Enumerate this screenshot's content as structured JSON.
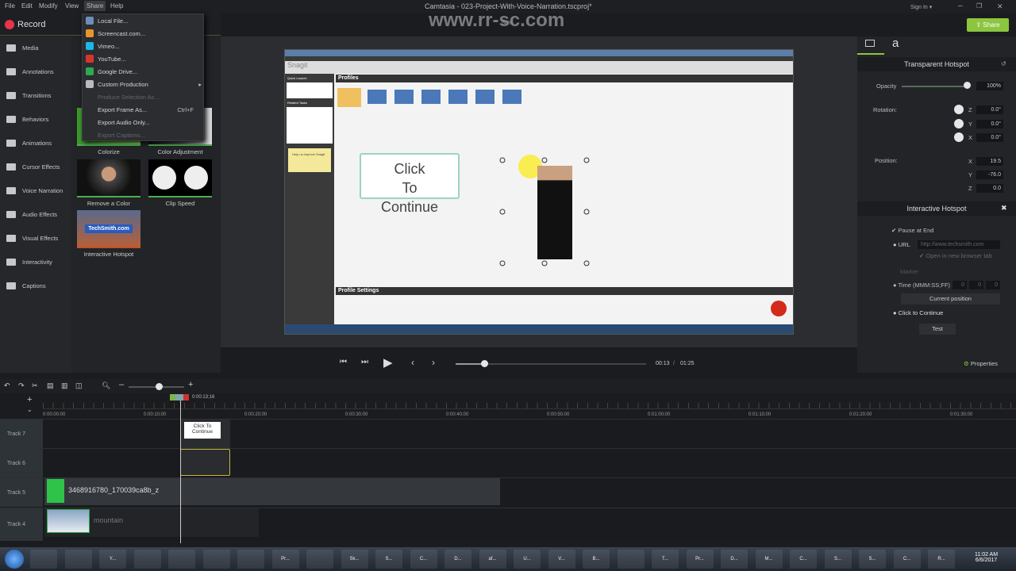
{
  "app": {
    "title": "Camtasia - 023-Project-With-Voice-Narration.tscproj*",
    "sign_in": "Sign In ▾",
    "share": "Share",
    "watermark": "www.rr-sc.com",
    "zoom": "50%",
    "accent": "#8cc63f"
  },
  "menu": [
    "File",
    "Edit",
    "Modify",
    "View",
    "Share",
    "Help"
  ],
  "record": "Record",
  "share_menu": [
    {
      "label": "Local File...",
      "icon": "local-file-icon",
      "color": "#6b8fb8",
      "disabled": false
    },
    {
      "label": "Screencast.com...",
      "icon": "screencast-icon",
      "color": "#e8962a",
      "disabled": false
    },
    {
      "label": "Vimeo...",
      "icon": "vimeo-icon",
      "color": "#1ab7ea",
      "disabled": false
    },
    {
      "label": "YouTube...",
      "icon": "youtube-icon",
      "color": "#d9342b",
      "disabled": false
    },
    {
      "label": "Google Drive...",
      "icon": "google-drive-icon",
      "color": "#2fa84f",
      "disabled": false
    },
    {
      "label": "Custom Production",
      "icon": "tools-icon",
      "color": "#bbbbbb",
      "disabled": false,
      "submenu": true
    },
    {
      "label": "Produce Selection As...",
      "icon": "",
      "color": "",
      "disabled": true
    },
    {
      "label": "Export Frame As...",
      "icon": "",
      "color": "",
      "disabled": false,
      "shortcut": "Ctrl+F"
    },
    {
      "label": "Export Audio Only...",
      "icon": "",
      "color": "",
      "disabled": false
    },
    {
      "label": "Export Captions...",
      "icon": "",
      "color": "",
      "disabled": true
    }
  ],
  "sidebar": [
    "Media",
    "Annotations",
    "Transitions",
    "Behaviors",
    "Animations",
    "Cursor Effects",
    "Voice Narration",
    "Audio Effects",
    "Visual Effects",
    "Interactivity",
    "Captions"
  ],
  "effects": [
    "Colorize",
    "Color Adjustment",
    "Remove a Color",
    "Clip Speed",
    "Interactive Hotspot"
  ],
  "hotspot_thumb_text": "TechSmith.com",
  "canvas": {
    "callout": "Click To Continue",
    "snagit": "Snagit",
    "quick_launch": "Quick Launch",
    "related_tasks": "Related Tasks",
    "profiles": "Profiles",
    "profile_settings": "Profile Settings",
    "improve": "Help us improve Snagit"
  },
  "properties": {
    "header": "Transparent Hotspot",
    "opacity_label": "Opacity",
    "opacity": "100%",
    "opacity_value": 1.0,
    "rotation_label": "Rotation:",
    "rotation": [
      {
        "axis": "Z",
        "value": "0.0°"
      },
      {
        "axis": "Y",
        "value": "0.0°"
      },
      {
        "axis": "X",
        "value": "0.0°"
      }
    ],
    "position_label": "Position:",
    "position": [
      {
        "axis": "X",
        "value": "19.5"
      },
      {
        "axis": "Y",
        "value": "-76.0"
      },
      {
        "axis": "Z",
        "value": "0.0"
      }
    ],
    "hotspot_header": "Interactive Hotspot",
    "pause_at_end": "Pause at End",
    "url_label": "URL",
    "url_value": "http://www.techsmith.com",
    "open_new_tab": "Open in new browser tab",
    "marker": "Marker",
    "time_label": "Time (MMM:SS;FF)",
    "time": [
      "0",
      "0",
      "0"
    ],
    "current_position": "Current position",
    "click_to_continue": "Click to Continue",
    "test": "Test",
    "properties_btn": "Properties"
  },
  "playback": {
    "current": "00:13",
    "total": "01:25",
    "progress": 0.15
  },
  "timeline": {
    "playhead": "0:00:13;16",
    "ticks": [
      "0:00:00;00",
      "0:00:10;00",
      "0:00:20;00",
      "0:00:30;00",
      "0:00:40;00",
      "0:00:50;00",
      "0:01:00;00",
      "0:01:10;00",
      "0:01:20;00",
      "0:01:30;00"
    ],
    "tracks": [
      {
        "name": "Track 7",
        "clip": "Click To Continue"
      },
      {
        "name": "Track 6",
        "clip": ""
      },
      {
        "name": "Track 5",
        "clip": "3468916780_170039ca8b_z"
      },
      {
        "name": "Track 4",
        "clip": "mountain"
      }
    ]
  },
  "taskbar": {
    "items": [
      "",
      "",
      "Y...",
      "",
      "",
      "",
      "",
      "Pr...",
      "",
      "Sk...",
      "S...",
      "C...",
      "D...",
      "af...",
      "U...",
      "V...",
      "B...",
      "",
      "T...",
      "Pr...",
      "D...",
      "M...",
      "C...",
      "S...",
      "S...",
      "C...",
      "R..."
    ],
    "time": "11:02 AM",
    "date": "6/6/2017"
  }
}
